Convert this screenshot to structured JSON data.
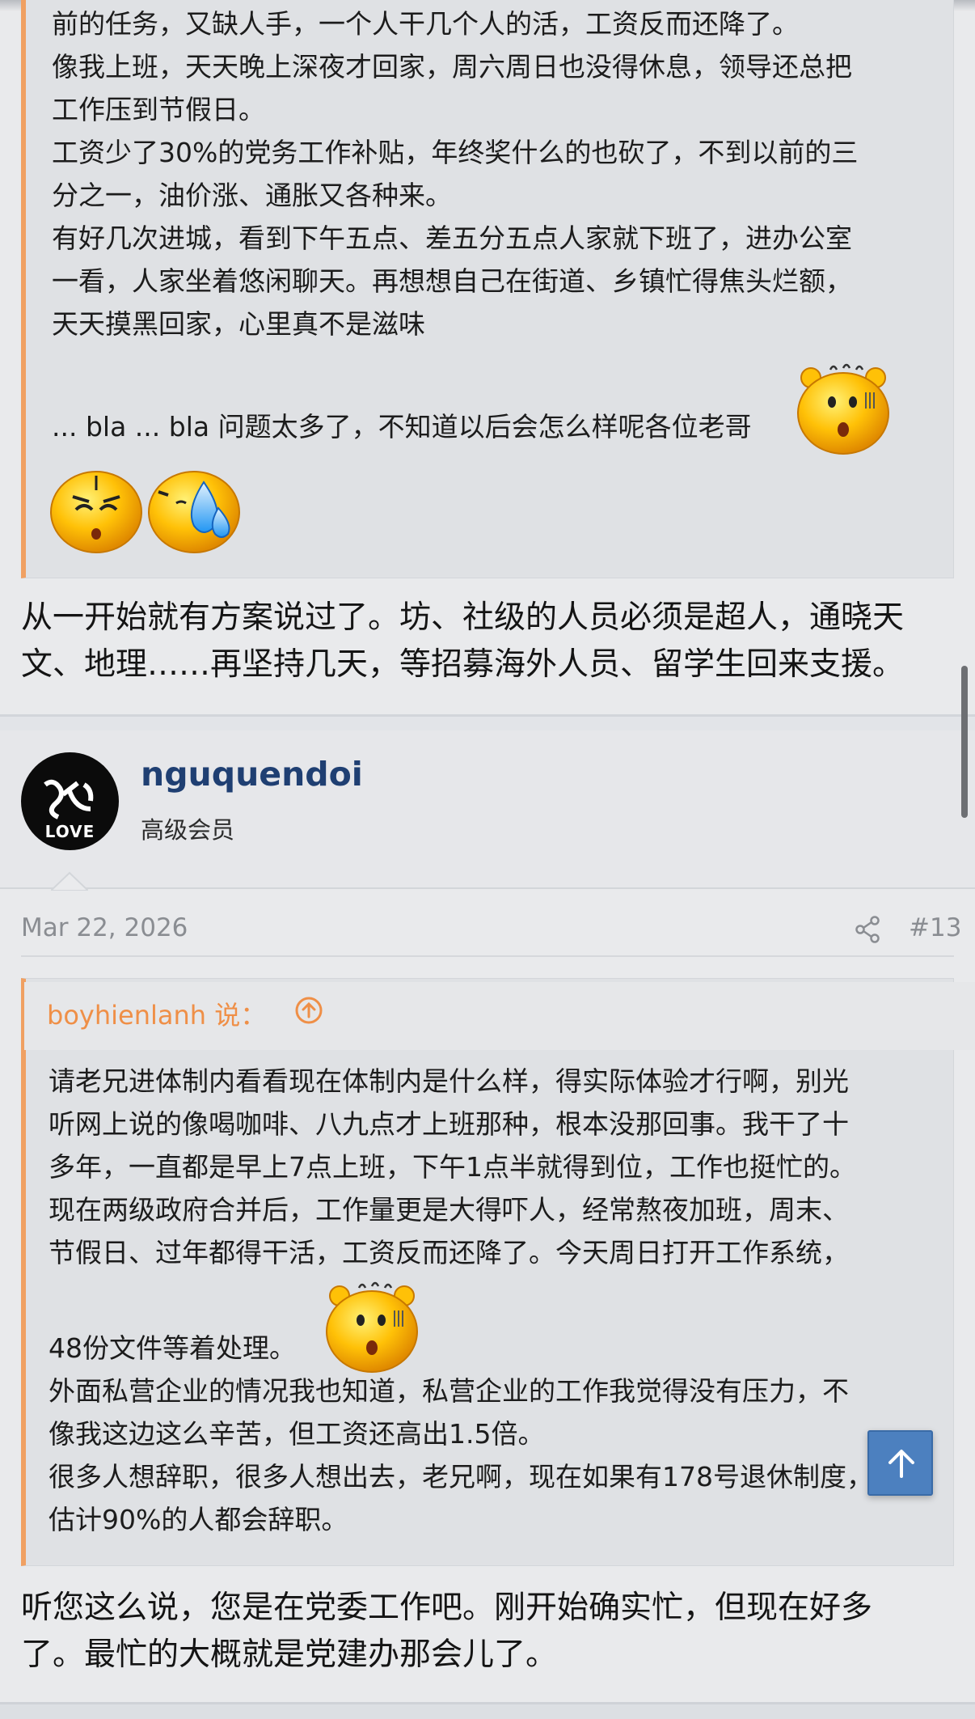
{
  "post12": {
    "quote_lines": [
      "前的任务，又缺人手，一个人干几个人的活，工资反而还降了。",
      "像我上班，天天晚上深夜才回家，周六周日也没得休息，领导还总把",
      "工作压到节假日。",
      "工资少了30%的党务工作补贴，年终奖什么的也砍了，不到以前的三",
      "分之一，油价涨、通胀又各种来。",
      "有好几次进城，看到下午五点、差五分五点人家就下班了，进办公室",
      "一看，人家坐着悠闲聊天。再想想自己在街道、乡镇忙得焦头烂额，",
      "天天摸黑回家，心里真不是滋味",
      "... bla ... bla 问题太多了，不知道以后会怎么样呢各位老哥"
    ],
    "reply_lines": [
      "从一开始就有方案说过了。坊、社级的人员必须是超人，通晓天",
      "文、地理……再坚持几天，等招募海外人员、留学生回来支援。"
    ]
  },
  "post13": {
    "username": "nguquendoi",
    "user_title": "高级会员",
    "avatar_text": "LOVE",
    "date": "Mar 22, 2026",
    "post_number": "#13",
    "quote_author": "boyhienlanh 说：",
    "quote_lines": [
      "请老兄进体制内看看现在体制内是什么样，得实际体验才行啊，别光",
      "听网上说的像喝咖啡、八九点才上班那种，根本没那回事。我干了十",
      "多年，一直都是早上7点上班，下午1点半就得到位，工作也挺忙的。",
      "现在两级政府合并后，工作量更是大得吓人，经常熬夜加班，周末、",
      "节假日、过年都得干活，工资反而还降了。今天周日打开工作系统，",
      "48份文件等着处理。",
      "外面私营企业的情况我也知道，私营企业的工作我觉得没有压力，不",
      "像我这边这么辛苦，但工资还高出1.5倍。",
      "很多人想辞职，很多人想出去，老兄啊，现在如果有178号退休制度，",
      "估计90%的人都会辞职。"
    ],
    "reply_lines": [
      "听您这么说，您是在党委工作吧。刚开始确实忙，但现在好多",
      "了。最忙的大概就是党建办那会儿了。"
    ]
  },
  "icons": {
    "emoji_a": "dizzy-face-icon",
    "emoji_b": "worried-face-icon",
    "emoji_c": "sweat-face-icon",
    "share": "share-icon",
    "jump": "arrow-up-circle-icon",
    "scroll_top": "arrow-up-icon"
  },
  "colors": {
    "accent_orange": "#f0a062",
    "username_blue": "#1f3f72",
    "scroll_button": "#4c80bf"
  }
}
